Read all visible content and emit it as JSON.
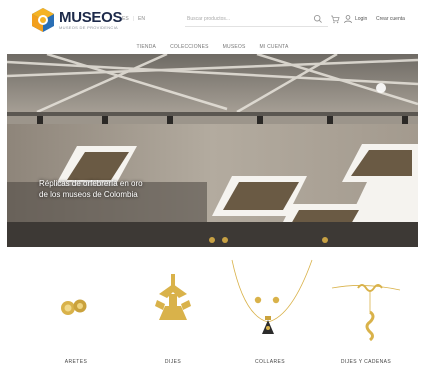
{
  "header": {
    "brand_name": "MUSEOS",
    "brand_subtitle": "MUSEOS DE PROVIDENCIA",
    "lang_es": "ES",
    "lang_en": "EN",
    "search_placeholder": "Buscar productos...",
    "login_label": "Login",
    "register_label": "Crear cuenta"
  },
  "nav": {
    "items": [
      "TIENDA",
      "COLECCIONES",
      "MUSEOS",
      "MI CUENTA"
    ]
  },
  "hero": {
    "caption_line1": "Réplicas de orfebrería en oro",
    "caption_line2": "de los museos de Colombia"
  },
  "products": [
    {
      "label": "ARETES",
      "icon": "earrings-icon"
    },
    {
      "label": "DIJES",
      "icon": "pendant-icon"
    },
    {
      "label": "COLLARES",
      "icon": "necklace-icon"
    },
    {
      "label": "DIJES Y CADENAS",
      "icon": "chain-pendant-icon"
    }
  ],
  "colors": {
    "gold": "#d9b24a",
    "brand_navy": "#1d2a4a",
    "logo_orange": "#f29f1d",
    "logo_blue": "#2a6fb5"
  }
}
